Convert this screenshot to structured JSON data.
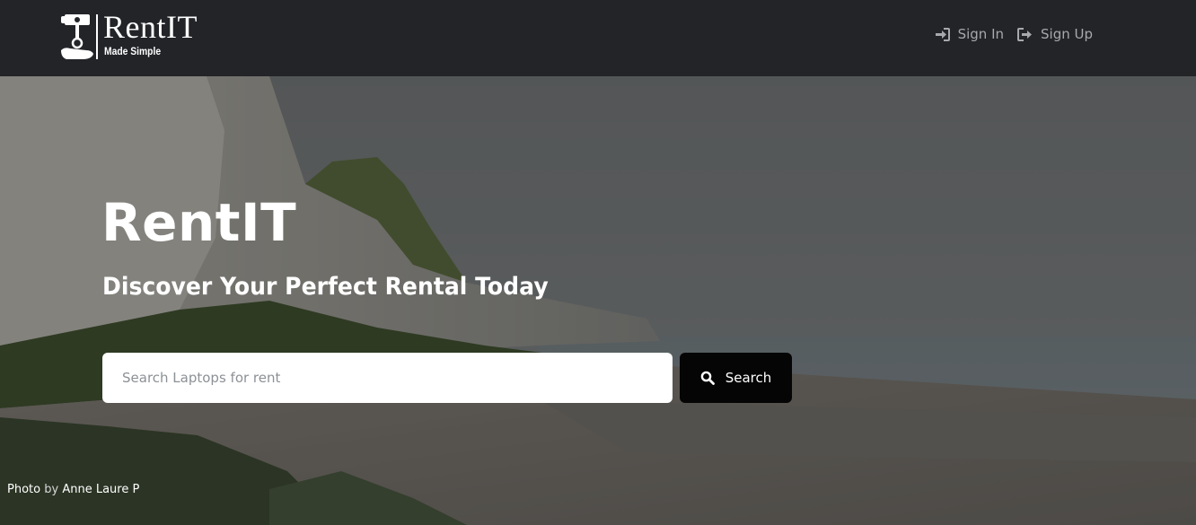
{
  "brand": {
    "name": "RentIT",
    "tagline": "Made Simple"
  },
  "nav": {
    "items": [
      {
        "label": "Sign In",
        "icon": "sign-in-icon"
      },
      {
        "label": "Sign Up",
        "icon": "sign-up-icon"
      }
    ]
  },
  "hero": {
    "title": "RentIT",
    "subtitle": "Discover Your Perfect Rental Today",
    "search": {
      "placeholder": "Search Laptops for rent",
      "value": "",
      "button_label": "Search",
      "button_icon": "search-icon"
    },
    "credit": {
      "photo_label": "Photo",
      "by_label": "by",
      "author": "Anne Laure P"
    }
  },
  "colors": {
    "navbar_bg": "#222428",
    "nav_text": "#a7a9ac",
    "search_button_bg": "#050505",
    "text_white": "#ffffff"
  }
}
